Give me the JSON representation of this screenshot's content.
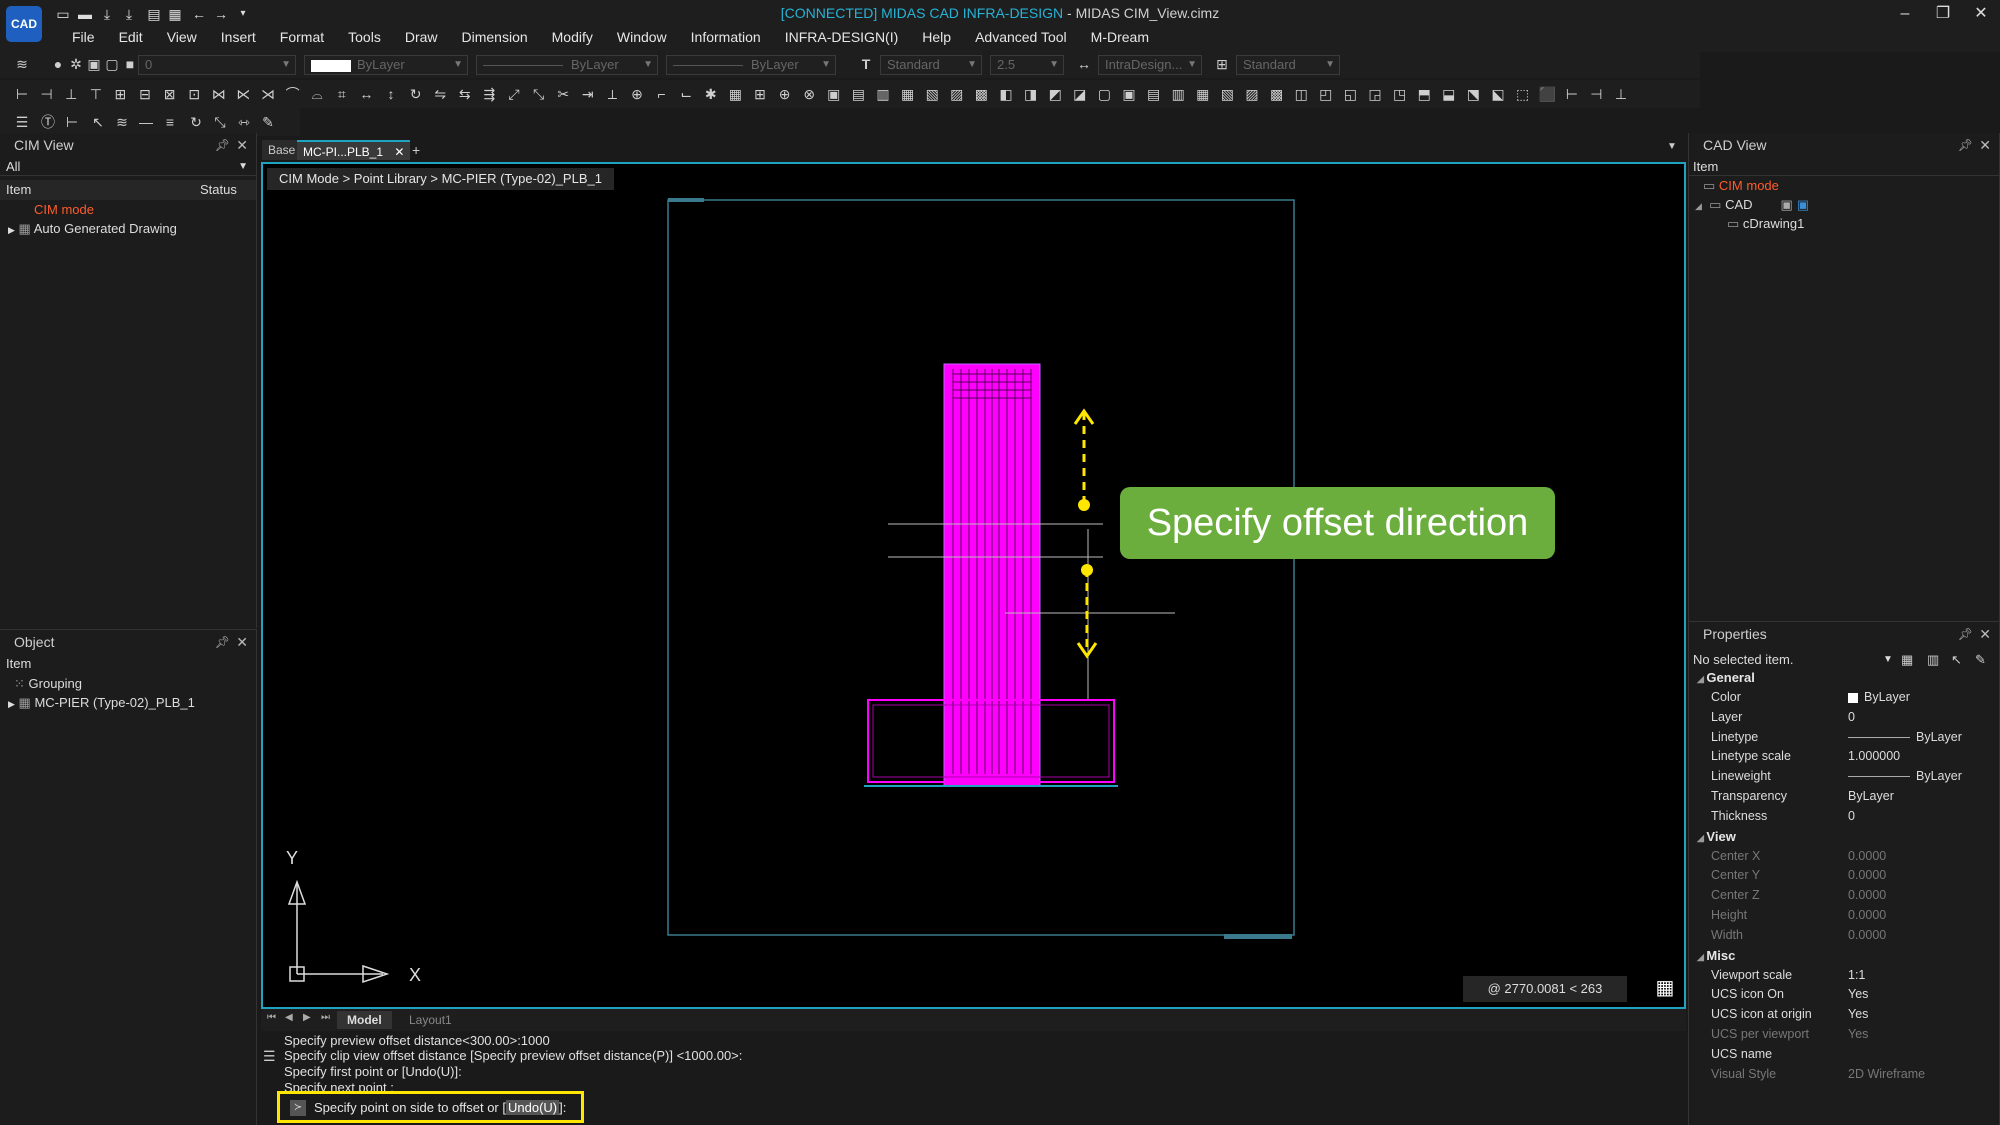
{
  "title": {
    "connected": "[CONNECTED] MIDAS CAD INFRA-DESIGN",
    "rest": " - MIDAS CIM_View.cimz"
  },
  "logo": "CAD",
  "menu": [
    "File",
    "Edit",
    "View",
    "Insert",
    "Format",
    "Tools",
    "Draw",
    "Dimension",
    "Modify",
    "Window",
    "Information",
    "INFRA-DESIGN(I)",
    "Help",
    "Advanced Tool",
    "M-Dream"
  ],
  "toolbar": {
    "layer": "0",
    "color": "ByLayer",
    "linetype": "ByLayer",
    "lineweight": "ByLayer",
    "textstyle": "Standard",
    "textsize": "2.5",
    "dimstyle": "IntraDesign...",
    "tablestyle": "Standard"
  },
  "cim_view": {
    "title": "CIM View",
    "filter": "All",
    "col_item": "Item",
    "col_status": "Status",
    "mode": "CIM mode",
    "items": [
      "Auto Generated Drawing"
    ]
  },
  "object_panel": {
    "title": "Object",
    "col_item": "Item",
    "items": [
      "Grouping",
      "MC-PIER (Type-02)_PLB_1"
    ]
  },
  "tabs": [
    "Base",
    "MC-PI...PLB_1"
  ],
  "breadcrumb": "CIM Mode > Point Library > MC-PIER (Type-02)_PLB_1",
  "callout": "Specify offset direction",
  "ucs": {
    "x": "X",
    "y": "Y"
  },
  "coords": "@ 2770.0081 < 263",
  "layout_tabs": [
    "Model",
    "Layout1"
  ],
  "command_history": [
    "Specify preview offset distance<300.00>:1000",
    "Specify clip view offset distance [Specify preview offset distance(P)] <1000.00>:",
    "Specify first point or [Undo(U)]:",
    "Specify next point :"
  ],
  "command_prompt": {
    "text": "Specify point on side to offset or [",
    "highlight": "Undo(U)",
    "end": "]:"
  },
  "cad_view": {
    "title": "CAD View",
    "col_item": "Item",
    "mode": "CIM mode",
    "cad": "CAD",
    "drawing": "cDrawing1"
  },
  "properties": {
    "title": "Properties",
    "selection": "No selected item.",
    "general_title": "General",
    "general": [
      [
        "Color",
        "ByLayer"
      ],
      [
        "Layer",
        "0"
      ],
      [
        "Linetype",
        "ByLayer"
      ],
      [
        "Linetype scale",
        "1.000000"
      ],
      [
        "Lineweight",
        "ByLayer"
      ],
      [
        "Transparency",
        "ByLayer"
      ],
      [
        "Thickness",
        "0"
      ]
    ],
    "view_title": "View",
    "view": [
      [
        "Center X",
        "0.0000"
      ],
      [
        "Center Y",
        "0.0000"
      ],
      [
        "Center Z",
        "0.0000"
      ],
      [
        "Height",
        "0.0000"
      ],
      [
        "Width",
        "0.0000"
      ]
    ],
    "misc_title": "Misc",
    "misc": [
      [
        "Viewport scale",
        "1:1"
      ],
      [
        "UCS icon On",
        "Yes"
      ],
      [
        "UCS icon at origin",
        "Yes"
      ],
      [
        "UCS per viewport",
        "Yes"
      ],
      [
        "UCS name",
        ""
      ],
      [
        "Visual Style",
        "2D Wireframe"
      ]
    ]
  },
  "colors": {
    "accent": "#1fa3c0",
    "magenta": "#ff00ff",
    "callout": "#6bae3e",
    "arrow": "#ffe600",
    "brand": "#1f5fbf"
  }
}
